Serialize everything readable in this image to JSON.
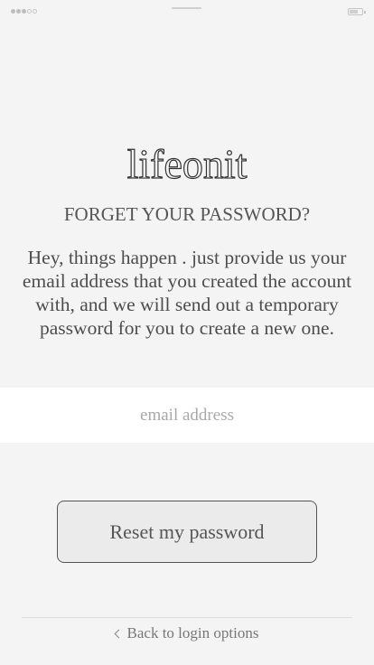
{
  "status_bar": {
    "signal_icon": "signal-dots-icon",
    "battery_icon": "battery-icon"
  },
  "app": {
    "logo_text": "lifeonit"
  },
  "screen": {
    "heading": "FORGET YOUR PASSWORD?",
    "description": "Hey, things happen . just provide us your email address that you created the account with, and we will send out a temporary password for you to create a new one."
  },
  "form": {
    "email_value": "",
    "email_placeholder": "email address",
    "reset_button_label": "Reset my password"
  },
  "footer": {
    "back_icon": "chevron-left-icon",
    "back_link_label": "Back to login options"
  }
}
